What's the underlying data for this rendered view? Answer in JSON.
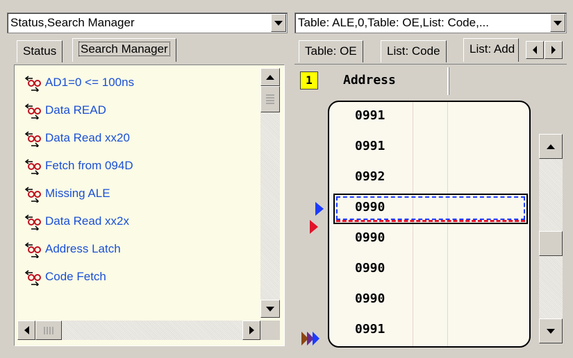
{
  "left_combo": {
    "value": "Status,Search Manager"
  },
  "right_combo": {
    "value": "Table: ALE,0,Table: OE,List: Code,..."
  },
  "left_tabs": [
    {
      "label": "Status"
    },
    {
      "label": "Search Manager"
    }
  ],
  "right_tabs": [
    {
      "label": "Table: OE"
    },
    {
      "label": "List: Code"
    },
    {
      "label": "List: Add"
    }
  ],
  "search_items": [
    {
      "label": "AD1=0 <= 100ns",
      "icon": "search-binoculars-icon"
    },
    {
      "label": "Data READ",
      "icon": "search-binoculars-icon"
    },
    {
      "label": "Data Read xx20",
      "icon": "search-binoculars-icon"
    },
    {
      "label": "Fetch from 094D",
      "icon": "search-binoculars-icon"
    },
    {
      "label": "Missing ALE",
      "icon": "search-binoculars-icon"
    },
    {
      "label": "Data Read xx2x",
      "icon": "search-binoculars-icon"
    },
    {
      "label": "Address Latch",
      "icon": "search-binoculars-icon"
    },
    {
      "label": "Code Fetch",
      "icon": "search-binoculars-icon"
    }
  ],
  "address_list": {
    "column_index": "1",
    "column_header": "Address",
    "rows": [
      "0991",
      "0991",
      "0992",
      "0990",
      "0990",
      "0990",
      "0990",
      "0991"
    ],
    "selected_row": 3
  },
  "colors": {
    "item_text": "#1a4fd6",
    "list_bg": "#fbfbe6",
    "marker_blue": "#1d3cff",
    "marker_red": "#e0142a",
    "index_badge": "#ffff00"
  }
}
